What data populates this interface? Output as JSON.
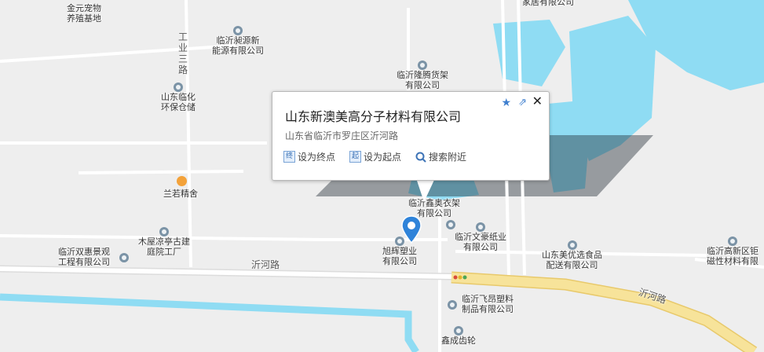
{
  "map": {
    "colors": {
      "background": "#eeeeee",
      "water": "#8fdcf3",
      "road": "#ffffff",
      "major_road": "#f7e39a",
      "major_road_edge": "#e8c96b",
      "poi_pin": "#7b93a6"
    },
    "pois": [
      {
        "id": "jinyuan",
        "lines": [
          "金元宠物",
          "养殖基地"
        ],
        "icon": "none"
      },
      {
        "id": "jiaju",
        "lines": [
          "家居有限公司"
        ],
        "icon": "none"
      },
      {
        "id": "chiyuan",
        "lines": [
          "临沂昶源新",
          "能源有限公司"
        ],
        "icon": "map-pin-icon"
      },
      {
        "id": "longteng",
        "lines": [
          "临沂隆腾货架",
          "有限公司"
        ],
        "icon": "map-pin-icon"
      },
      {
        "id": "linhua",
        "lines": [
          "山东临化",
          "环保仓储"
        ],
        "icon": "map-pin-icon"
      },
      {
        "id": "lanruo",
        "lines": [
          "兰若精舍"
        ],
        "icon": "cup-icon"
      },
      {
        "id": "xinao",
        "lines": [
          "临沂鑫奥衣架",
          "有限公司"
        ],
        "icon": "map-pin-icon"
      },
      {
        "id": "wenhao",
        "lines": [
          "临沂文豪纸业",
          "有限公司"
        ],
        "icon": "map-pin-icon"
      },
      {
        "id": "muwu",
        "lines": [
          "木屋凉亭古建",
          "庭院工厂"
        ],
        "icon": "map-pin-icon"
      },
      {
        "id": "shuanghui",
        "lines": [
          "临沂双惠景观",
          "工程有限公司"
        ],
        "icon": "map-pin-icon"
      },
      {
        "id": "xuhui",
        "lines": [
          "旭辉塑业",
          "有限公司"
        ],
        "icon": "map-pin-icon"
      },
      {
        "id": "meiyou",
        "lines": [
          "山东美优选食品",
          "配送有限公司"
        ],
        "icon": "map-pin-icon"
      },
      {
        "id": "gaoxin",
        "lines": [
          "临沂高新区钜",
          "磁性材料有限"
        ],
        "icon": "map-pin-icon"
      },
      {
        "id": "feiang",
        "lines": [
          "临沂飞昂塑料",
          "制品有限公司"
        ],
        "icon": "map-pin-icon"
      },
      {
        "id": "xincheng",
        "lines": [
          "鑫成齿轮"
        ],
        "icon": "map-pin-icon"
      }
    ],
    "road_labels": {
      "gongye": "工\n业\n三\n路",
      "yihe_1": "沂河路",
      "yihe_2": "沂河路"
    }
  },
  "popup": {
    "title": "山东新澳美高分子材料有限公司",
    "address": "山东省临沂市罗庄区沂河路",
    "actions": [
      {
        "id": "end",
        "icon_char": "终",
        "label": "设为终点",
        "icon": "end-point-icon"
      },
      {
        "id": "start",
        "icon_char": "起",
        "label": "设为起点",
        "icon": "start-point-icon"
      },
      {
        "id": "nearby",
        "icon_char": "",
        "label": "搜索附近",
        "icon": "search-nearby-icon"
      }
    ],
    "close_glyph": "✕",
    "favorite_glyph": "★",
    "share_glyph": "⇗"
  }
}
